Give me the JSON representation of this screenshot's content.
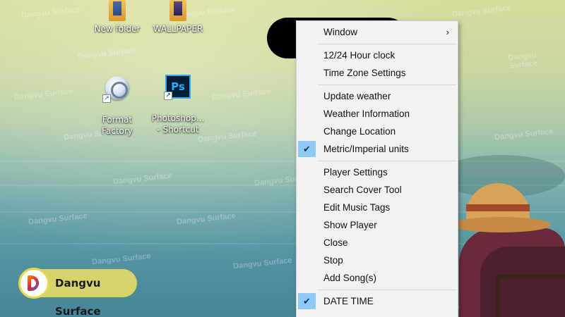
{
  "desktop": {
    "icons": [
      {
        "label": "New folder"
      },
      {
        "label": "WALLPAPER"
      },
      {
        "label": "Format\nFactory"
      },
      {
        "label": "Photoshop...\n- Shortcut"
      }
    ]
  },
  "context_menu": {
    "items": [
      {
        "label": "Window",
        "has_submenu": true,
        "checked": false
      },
      {
        "label": "12/24 Hour clock",
        "checked": false
      },
      {
        "label": "Time Zone Settings",
        "checked": false
      },
      {
        "label": "Update weather",
        "checked": false
      },
      {
        "label": "Weather Information",
        "checked": false
      },
      {
        "label": "Change Location",
        "checked": false
      },
      {
        "label": "Metric/Imperial units",
        "checked": true
      },
      {
        "label": "Player Settings",
        "checked": false
      },
      {
        "label": "Search Cover Tool",
        "checked": false
      },
      {
        "label": "Edit Music Tags",
        "checked": false
      },
      {
        "label": "Show Player",
        "checked": false
      },
      {
        "label": "Close",
        "checked": false
      },
      {
        "label": "Stop",
        "checked": false
      },
      {
        "label": "Add Song(s)",
        "checked": false
      },
      {
        "label": "DATE TIME",
        "checked": true
      }
    ],
    "check_glyph": "✔",
    "submenu_glyph": "›",
    "check_color": "#90c8f6"
  },
  "watermark": {
    "text": "Dangvu Surface"
  },
  "brand": {
    "text": "Dangvu Surface",
    "color": "#d6d36a"
  }
}
